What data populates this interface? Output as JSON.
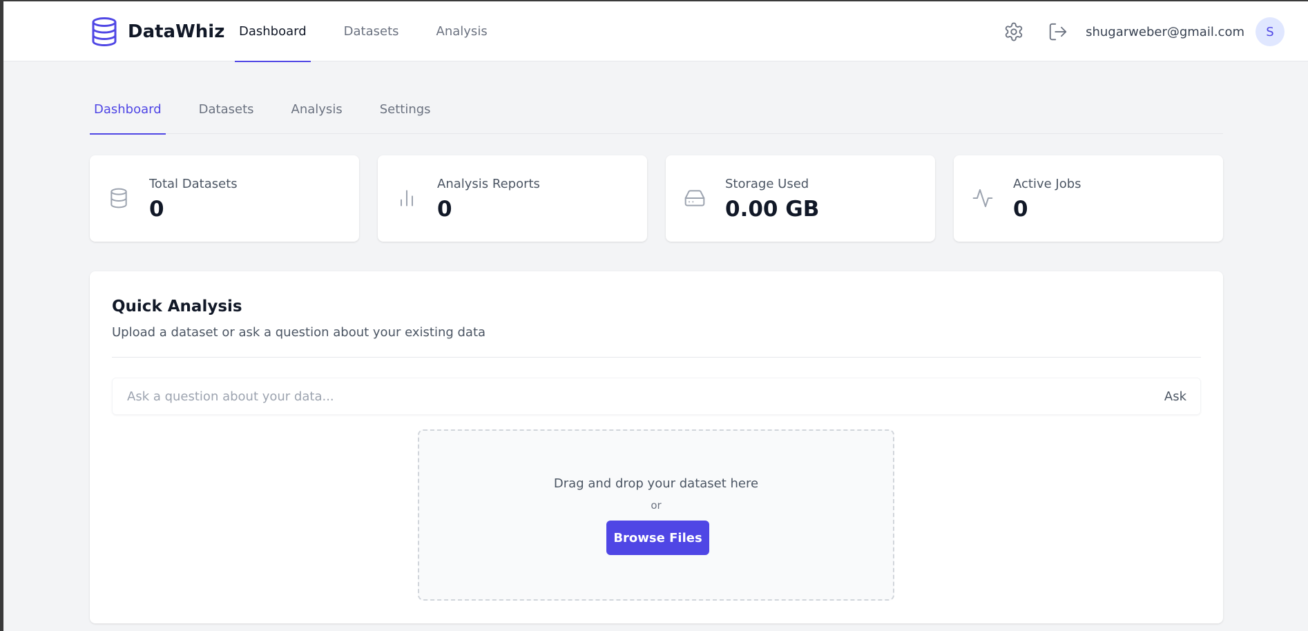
{
  "brand": {
    "name": "DataWhiz",
    "icon": "database-icon",
    "color": "#4f46e5"
  },
  "topnav": [
    {
      "label": "Dashboard",
      "active": true
    },
    {
      "label": "Datasets",
      "active": false
    },
    {
      "label": "Analysis",
      "active": false
    }
  ],
  "header": {
    "settings_icon": "gear-icon",
    "logout_icon": "logout-icon",
    "user_email": "shugarweber@gmail.com",
    "avatar_initial": "S"
  },
  "subtabs": [
    {
      "label": "Dashboard",
      "active": true
    },
    {
      "label": "Datasets",
      "active": false
    },
    {
      "label": "Analysis",
      "active": false
    },
    {
      "label": "Settings",
      "active": false
    }
  ],
  "stats": [
    {
      "label": "Total Datasets",
      "value": "0",
      "icon": "database-icon"
    },
    {
      "label": "Analysis Reports",
      "value": "0",
      "icon": "bar-chart-icon"
    },
    {
      "label": "Storage Used",
      "value": "0.00 GB",
      "icon": "hard-drive-icon"
    },
    {
      "label": "Active Jobs",
      "value": "0",
      "icon": "activity-icon"
    }
  ],
  "quick_analysis": {
    "title": "Quick Analysis",
    "description": "Upload a dataset or ask a question about your existing data",
    "ask_placeholder": "Ask a question about your data...",
    "ask_value": "",
    "ask_button": "Ask",
    "dropzone_title": "Drag and drop your dataset here",
    "dropzone_or": "or",
    "browse_button": "Browse Files"
  },
  "colors": {
    "accent": "#4f46e5",
    "background": "#f3f4f6",
    "card": "#ffffff"
  }
}
